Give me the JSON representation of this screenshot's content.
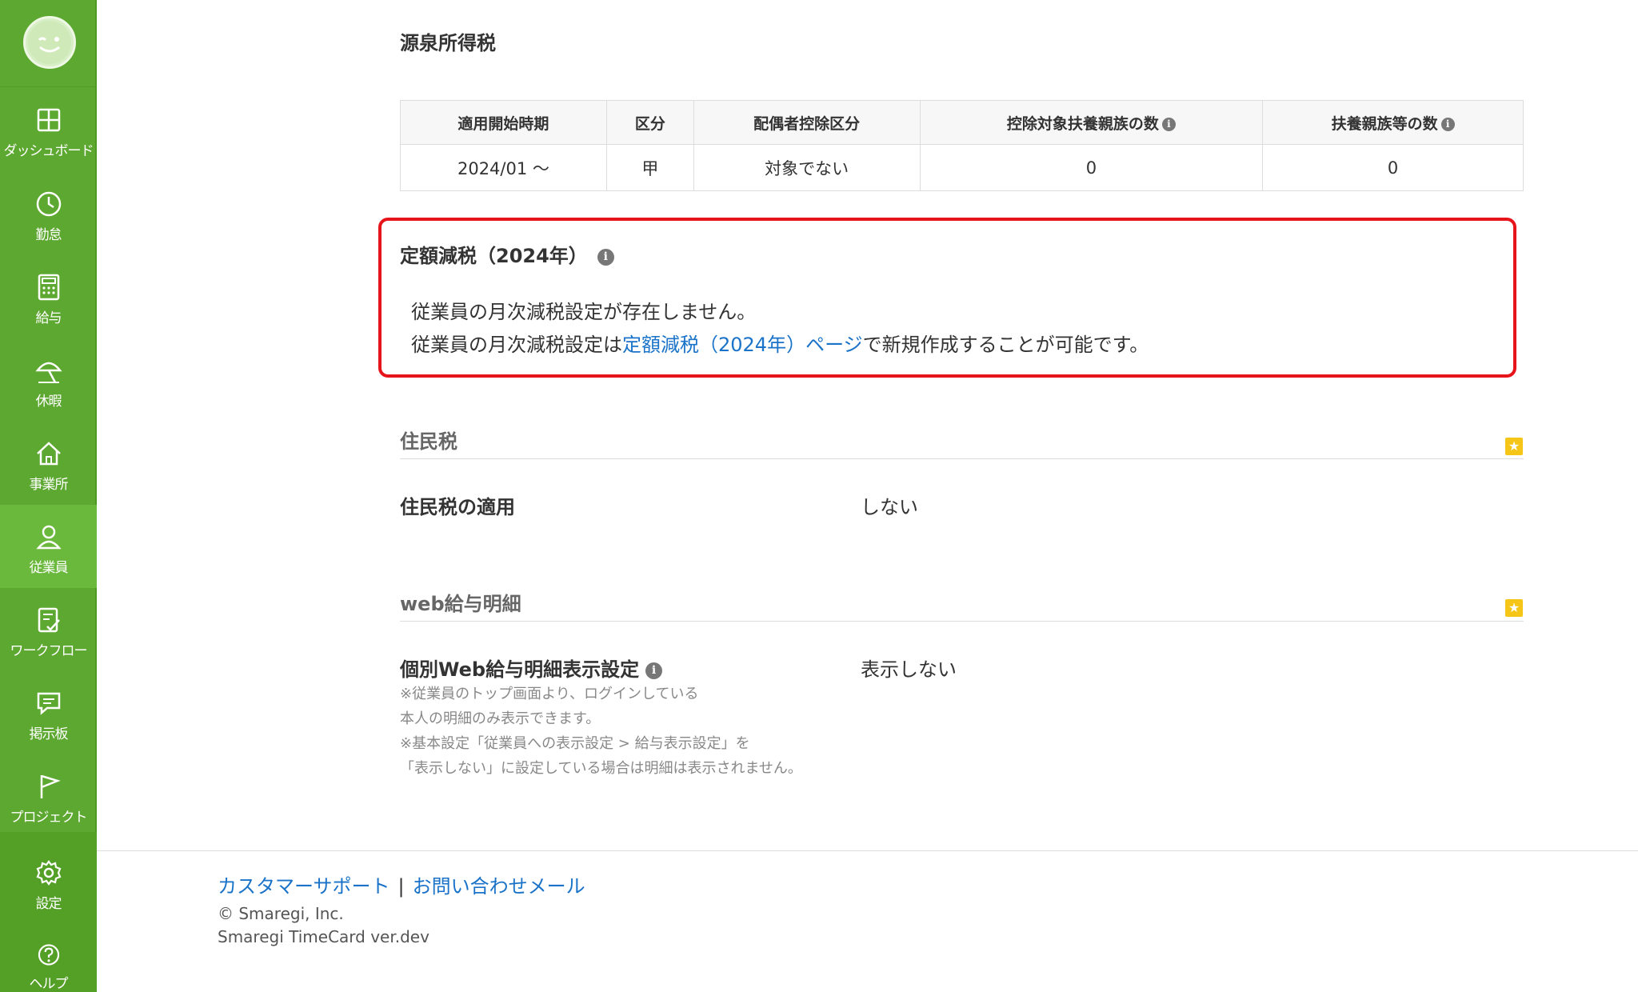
{
  "sidebar": {
    "items": [
      {
        "label": "ダッシュボード",
        "icon": "dashboard-icon"
      },
      {
        "label": "勤怠",
        "icon": "clock-icon"
      },
      {
        "label": "給与",
        "icon": "calculator-icon"
      },
      {
        "label": "休暇",
        "icon": "umbrella-icon"
      },
      {
        "label": "事業所",
        "icon": "home-icon"
      },
      {
        "label": "従業員",
        "icon": "user-icon"
      },
      {
        "label": "ワークフロー",
        "icon": "checklist-icon"
      },
      {
        "label": "掲示板",
        "icon": "message-icon"
      },
      {
        "label": "プロジェクト",
        "icon": "flag-icon"
      },
      {
        "label": "設定",
        "icon": "gear-icon"
      },
      {
        "label": "ヘルプ",
        "icon": "help-icon"
      }
    ],
    "active": "従業員",
    "accent": "#5da830"
  },
  "withholding": {
    "title": "源泉所得税",
    "headers": [
      "適用開始時期",
      "区分",
      "配偶者控除区分",
      "控除対象扶養親族の数",
      "扶養親族等の数"
    ],
    "row": [
      "2024/01 〜",
      "甲",
      "対象でない",
      "0",
      "0"
    ]
  },
  "fixed_tax": {
    "title": "定額減税（2024年）",
    "line1": "従業員の月次減税設定が存在しません。",
    "line2_prefix": "従業員の月次減税設定は",
    "line2_link": "定額減税（2024年）ページ",
    "line2_suffix": "で新規作成することが可能です。",
    "highlight_color": "#e8141c"
  },
  "resident_tax": {
    "heading": "住民税",
    "label": "住民税の適用",
    "value": "しない"
  },
  "web_payslip": {
    "heading": "web給与明細",
    "label": "個別Web給与明細表示設定",
    "value": "表示しない",
    "notes": [
      "※従業員のトップ画面より、ログインしている",
      "本人の明細のみ表示できます。",
      "※基本設定「従業員への表示設定 > 給与表示設定」を",
      "「表示しない」に設定している場合は明細は表示されません。"
    ]
  },
  "footer": {
    "support_link": "カスタマーサポート",
    "separator": "|",
    "mail_link": "お問い合わせメール",
    "copyright": "© Smaregi, Inc.",
    "version": "Smaregi TimeCard ver.dev"
  }
}
